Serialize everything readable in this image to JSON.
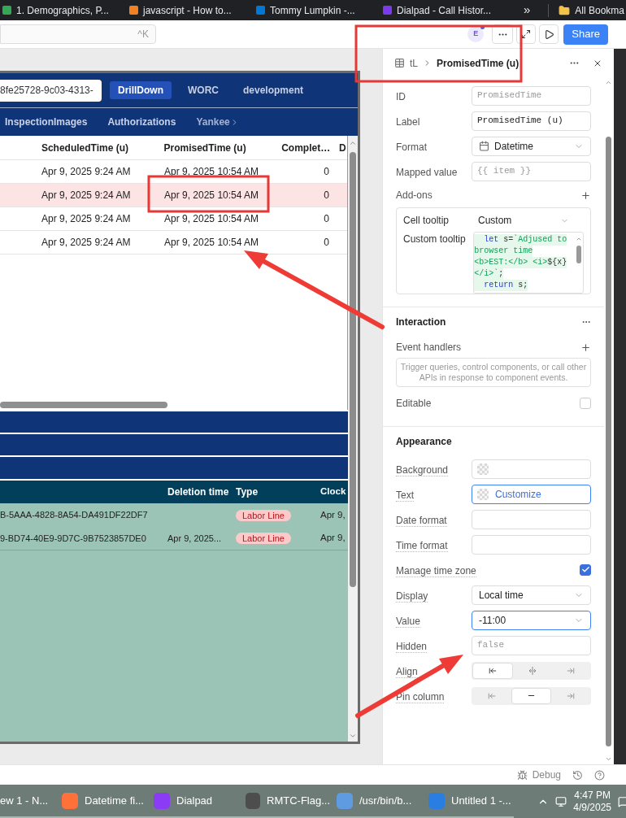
{
  "browser_bookmarks": [
    {
      "label": "1. Demographics, P...",
      "color": "#34a853"
    },
    {
      "label": "javascript - How to...",
      "color": "#f48024"
    },
    {
      "label": "Tommy Lumpkin -...",
      "color": "#0078d4"
    },
    {
      "label": "Dialpad - Call Histor...",
      "color": "#7c3aed"
    }
  ],
  "bookmarks_more": "»",
  "all_bookmarks": "All Bookma",
  "toolbar": {
    "search_shortcut": "^K",
    "avatar": "E",
    "share": "Share"
  },
  "canvas": {
    "header": {
      "id_value": "8fe25728-9c03-4313-",
      "tabs": [
        {
          "label": "DrillDown",
          "selected": true
        },
        {
          "label": "WORC",
          "selected": false
        },
        {
          "label": "development",
          "selected": false
        }
      ]
    },
    "nav": [
      "InspectionImages",
      "Authorizations",
      "Yankee"
    ],
    "table": {
      "columns": [
        "ScheduledTime (u)",
        "PromisedTime (u)",
        "Complet…",
        "D"
      ],
      "rows": [
        {
          "cells": [
            "Apr 9, 2025 9:24 AM",
            "Apr 9, 2025 10:54 AM",
            "0"
          ],
          "selected": false
        },
        {
          "cells": [
            "Apr 9, 2025 9:24 AM",
            "Apr 9, 2025 10:54 AM",
            "0"
          ],
          "selected": true
        },
        {
          "cells": [
            "Apr 9, 2025 9:24 AM",
            "Apr 9, 2025 10:54 AM",
            "0"
          ],
          "selected": false
        },
        {
          "cells": [
            "Apr 9, 2025 9:24 AM",
            "Apr 9, 2025 10:54 AM",
            "0"
          ],
          "selected": false
        }
      ]
    },
    "labor_table": {
      "columns": [
        "Deletion time",
        "Type",
        "Clock"
      ],
      "rows": [
        {
          "id": "B-5AAA-4828-8A54-DA491DF22DF7",
          "type": "Labor Line",
          "clock": "Apr 9,"
        },
        {
          "id": "9-BD74-40E9-9D7C-9B7523857DE0",
          "deletion_time": "Apr 9, 2025...",
          "type": "Labor Line",
          "clock": "Apr 9,"
        }
      ]
    }
  },
  "inspector": {
    "breadcrumb_parent": "tL",
    "title": "PromisedTime (u)",
    "fields": [
      {
        "label": "ID",
        "kind": "code",
        "placeholder": "PromisedTime"
      },
      {
        "label": "Label",
        "kind": "code",
        "value": "PromisedTime (u)"
      },
      {
        "label": "Format",
        "kind": "select",
        "value": "Datetime"
      },
      {
        "label": "Mapped value",
        "kind": "code",
        "placeholder": "{{ item }}"
      }
    ],
    "addons": {
      "title": "Add-ons",
      "cell_tooltip_label": "Cell tooltip",
      "cell_tooltip_value": "Custom",
      "custom_tooltip_label": "Custom tooltip",
      "code_lines": [
        [
          {
            "text": "  let",
            "kind": "keyword"
          },
          {
            "text": " s=",
            "kind": "plain"
          },
          {
            "text": "`Adjused to",
            "kind": "string"
          }
        ],
        [
          {
            "text": "browser time",
            "kind": "string"
          }
        ],
        [
          {
            "text": "<b>EST:</b> <i>",
            "kind": "string"
          },
          {
            "text": "${x}",
            "kind": "plain"
          }
        ],
        [
          {
            "text": "</i>`",
            "kind": "string"
          },
          {
            "text": ";",
            "kind": "plain"
          }
        ],
        [
          {
            "text": "  return",
            "kind": "keyword"
          },
          {
            "text": " s;",
            "kind": "plain"
          }
        ]
      ]
    },
    "interaction": {
      "title": "Interaction",
      "event_handlers_label": "Event handlers",
      "event_handlers_placeholder": "Trigger queries, control components, or call other APIs in response to component events.",
      "editable_label": "Editable",
      "editable_checked": false
    },
    "appearance": {
      "title": "Appearance",
      "fields": [
        {
          "label": "Background",
          "kind": "color",
          "focused": false
        },
        {
          "label": "Text",
          "kind": "color",
          "value": "Customize",
          "focused": true
        },
        {
          "label": "Date format",
          "kind": "code",
          "focused": false
        },
        {
          "label": "Time format",
          "kind": "code",
          "focused": false
        },
        {
          "label": "Manage time zone",
          "kind": "checkbox",
          "checked": true
        },
        {
          "label": "Display",
          "kind": "select",
          "value": "Local time",
          "focused": false
        },
        {
          "label": "Value",
          "kind": "select",
          "value": "-11:00",
          "focused": true
        },
        {
          "label": "Hidden",
          "kind": "code",
          "placeholder": "false",
          "focused": false
        },
        {
          "label": "Align",
          "kind": "segmented",
          "options": [
            {
              "selected": true
            },
            {
              "selected": false
            },
            {
              "selected": false
            }
          ]
        },
        {
          "label": "Pin column",
          "kind": "segmented",
          "options": [
            {
              "selected": false
            },
            {
              "selected": true
            },
            {
              "selected": false
            }
          ]
        }
      ]
    }
  },
  "footer": {
    "debug": "Debug"
  },
  "taskbar": {
    "items": [
      "ew 1 - N...",
      "Datetime fi...",
      "Dialpad",
      "RMTC-Flag...",
      "/usr/bin/b...",
      "Untitled 1 -..."
    ],
    "time": "4:47 PM",
    "date": "4/9/2025"
  }
}
